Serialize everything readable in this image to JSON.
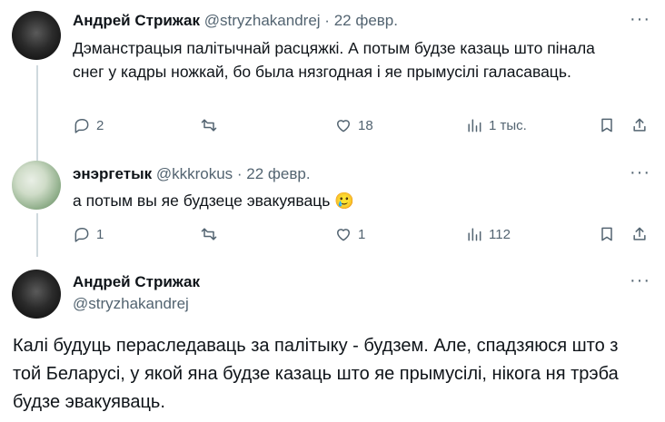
{
  "tweet1": {
    "name": "Андрей Стрижак",
    "handle": "@stryzhakandrej",
    "date": "22 февр.",
    "text": "Дэманстрацыя палітычнай расцяжкі. А потым будзе казаць што пінала снег у кадры ножкай, бо была нязгодная і яе прымусілі галасаваць.",
    "replies": "2",
    "likes": "18",
    "views": "1 тыс."
  },
  "tweet2": {
    "name": "энэргетык",
    "handle": "@kkkrokus",
    "date": "22 февр.",
    "text": "а потым вы яе будзеце эвакуяваць",
    "emoji": "🥲",
    "replies": "1",
    "likes": "1",
    "views": "112"
  },
  "tweet3": {
    "name": "Андрей Стрижак",
    "handle": "@stryzhakandrej",
    "text": "Калі будуць пераследаваць за палітыку - будзем. Але, спадзяюся што з той Беларусі, у якой яна будзе казаць што яе прымусілі, нікога ня трэба будзе эвакуяваць."
  },
  "separator": "·",
  "more_glyph": "···"
}
